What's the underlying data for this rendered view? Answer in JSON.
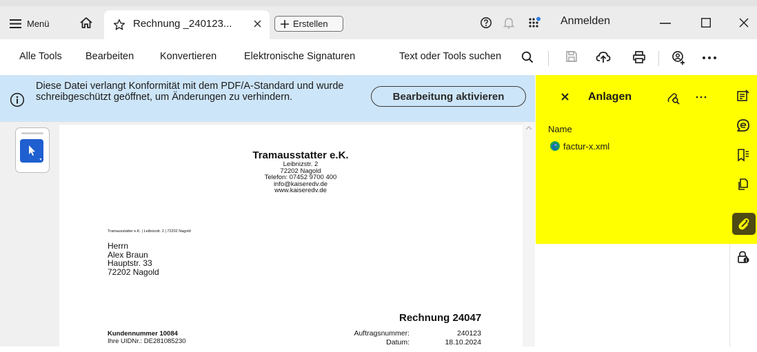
{
  "titlebar": {
    "menu_label": "Menü",
    "tab_title": "Rechnung _240123...",
    "create_label": "Erstellen",
    "signin_label": "Anmelden"
  },
  "toolbar": {
    "items": [
      "Alle Tools",
      "Bearbeiten",
      "Konvertieren",
      "Elektronische Signaturen"
    ],
    "search_label": "Text oder Tools suchen"
  },
  "banner": {
    "message": "Diese Datei verlangt Konformität mit dem PDF/A-Standard und wurde schreibgeschützt geöffnet, um Änderungen zu verhindern.",
    "button_label": "Bearbeitung aktivieren"
  },
  "invoice": {
    "company": "Tramausstatter e.K.",
    "street": "Leibnizstr. 2",
    "city": "72202 Nagold",
    "phone": "Telefon: 07452 9700 400",
    "email": "info@kaiseredv.de",
    "web": "www.kaiseredv.de",
    "sender_line": "Tramausstatter e.K. | Leibnizstr. 2 | 72202 Nagold",
    "recipient": [
      "Herrn",
      "Alex Braun",
      "Hauptstr. 33",
      "72202 Nagold"
    ],
    "heading": "Rechnung 24047",
    "customer_number": "Kundennummer 10084",
    "vat_id": "Ihre UIDNr.: DE281085230",
    "order_label": "Auftragsnummer:",
    "order_value": "240123",
    "date_label": "Datum:",
    "date_value": "18.10.2024"
  },
  "panel": {
    "title": "Anlagen",
    "column_name": "Name",
    "files": [
      "factur-x.xml"
    ]
  },
  "colors": {
    "panel_highlight": "#ffff00",
    "banner_bg": "#cde5f8",
    "select_tool": "#1f5fd0",
    "rail_active": "#4e4a14"
  },
  "icons": {
    "rail": [
      "edit-text-icon",
      "comment-icon",
      "bookmark-icon",
      "pages-icon",
      "attachment-icon",
      "security-icon"
    ]
  }
}
